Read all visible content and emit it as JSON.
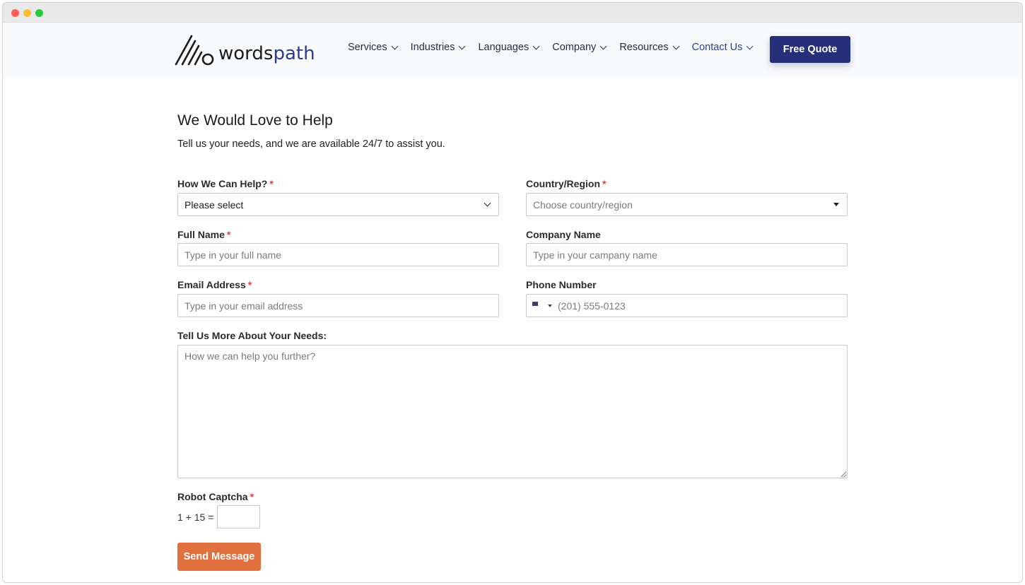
{
  "header": {
    "logo": {
      "part1": "words",
      "part2": "path"
    },
    "nav": [
      {
        "label": "Services"
      },
      {
        "label": "Industries"
      },
      {
        "label": "Languages"
      },
      {
        "label": "Company"
      },
      {
        "label": "Resources"
      },
      {
        "label": "Contact Us"
      }
    ],
    "quote_button": "Free Quote"
  },
  "form": {
    "title": "We Would Love to Help",
    "subtitle": "Tell us your needs, and we are available 24/7 to assist you.",
    "help": {
      "label": "How We Can Help?",
      "required": "*",
      "value": "Please select"
    },
    "country": {
      "label": "Country/Region",
      "required": "*",
      "placeholder": "Choose country/region"
    },
    "full_name": {
      "label": "Full Name",
      "required": "*",
      "placeholder": "Type in your full name"
    },
    "company": {
      "label": "Company Name",
      "placeholder": "Type in your campany name"
    },
    "email": {
      "label": "Email Address",
      "required": "*",
      "placeholder": "Type in your email address"
    },
    "phone": {
      "label": "Phone Number",
      "placeholder": "(201) 555-0123",
      "flag": "us-flag-icon"
    },
    "needs": {
      "label": "Tell Us More About Your Needs:",
      "placeholder": "How we can help you further?"
    },
    "captcha": {
      "label": "Robot Captcha",
      "required": "*",
      "question": "1 + 15 ="
    },
    "send_button": "Send Message"
  },
  "colors": {
    "brand_navy": "#26307a",
    "send_orange": "#e0703e",
    "required_red": "#e0413a"
  }
}
